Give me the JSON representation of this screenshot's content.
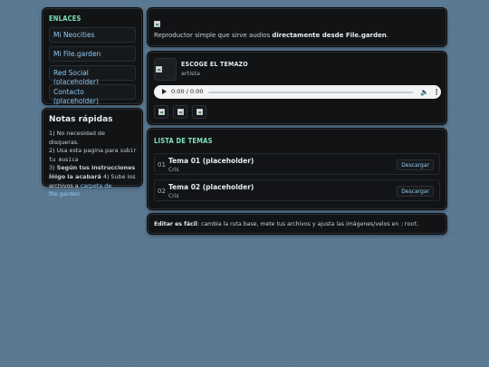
{
  "sidebar": {
    "links_title": "ENLACES",
    "links": [
      {
        "label": "Mi Neocities"
      },
      {
        "label": "Mi File.garden"
      },
      {
        "label": "Red Social (placeholder)"
      },
      {
        "label": "Contacto (placeholder)"
      }
    ],
    "notes": {
      "title": "Notas rápidas",
      "line1": "1) No necesidad de disqueras.",
      "line2_prefix": "2) Usa esta pagina para ",
      "line2_code": "subir tu musica",
      "line3_prefix": "3) ",
      "line3_bold": "Según tus instrucciones Íñigo la acabará",
      "line3_mid": " 4) Sube los archivos a ",
      "line3_link": "carpeta de file.garden"
    }
  },
  "header": {
    "text_prefix": "Reproductor simple que sirve audios ",
    "text_bold": "directamente desde File.garden",
    "text_suffix": "."
  },
  "player": {
    "title": "ESCOGE EL TEMAZO",
    "artist": "artista",
    "time": "0:00 / 0:00",
    "progress": 0
  },
  "tracklist": {
    "title": "LISTA DE TEMAS",
    "tracks": [
      {
        "num": "01",
        "title": "Tema 01 (placeholder)",
        "artist": "Cris",
        "download": "Descargar"
      },
      {
        "num": "02",
        "title": "Tema 02 (placeholder)",
        "artist": "Cris",
        "download": "Descargar"
      }
    ]
  },
  "footer": {
    "bold": "Editar es fácil",
    "text": ": cambia la ruta base, mete tus archivos y ajusta las imágenes/velos en ",
    "code": ":root",
    "end": "."
  },
  "colors": {
    "background": "#5b7a93",
    "panel": "#111315",
    "accent_green": "#7ee3b5",
    "link_blue": "#8ec8f2"
  }
}
